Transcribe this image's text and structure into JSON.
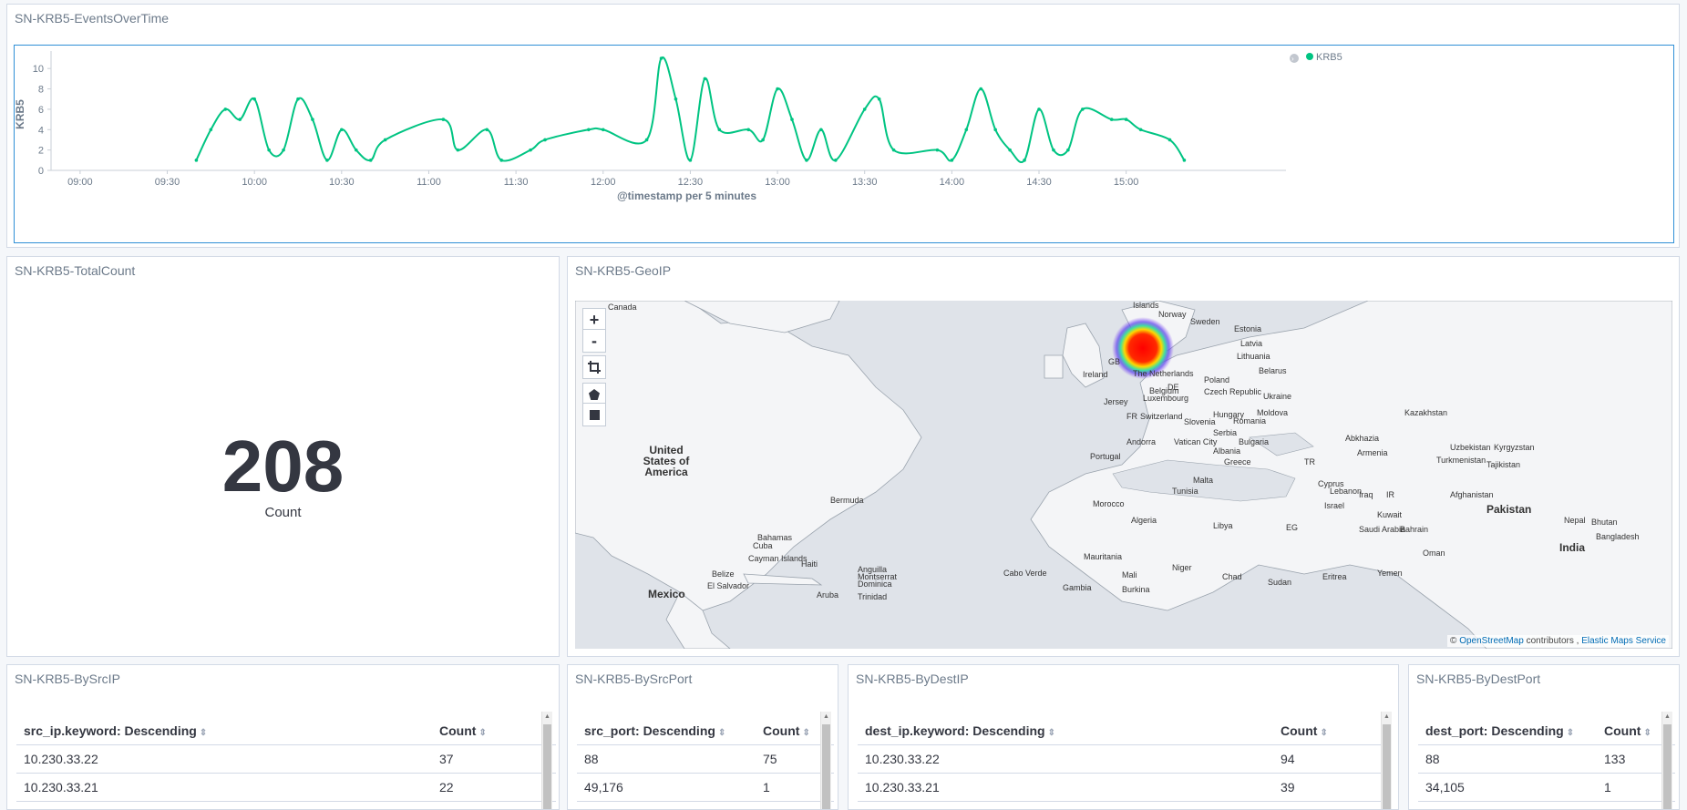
{
  "panels": {
    "events": {
      "title": "SN-KRB5-EventsOverTime"
    },
    "total": {
      "title": "SN-KRB5-TotalCount",
      "value": "208",
      "label": "Count"
    },
    "geo": {
      "title": "SN-KRB5-GeoIP"
    },
    "srcip": {
      "title": "SN-KRB5-BySrcIP",
      "headers": [
        "src_ip.keyword: Descending",
        "Count"
      ],
      "rows": [
        [
          "10.230.33.22",
          "37"
        ],
        [
          "10.230.33.21",
          "22"
        ]
      ]
    },
    "srcport": {
      "title": "SN-KRB5-BySrcPort",
      "headers": [
        "src_port: Descending",
        "Count"
      ],
      "rows": [
        [
          "88",
          "75"
        ],
        [
          "49,176",
          "1"
        ]
      ]
    },
    "destip": {
      "title": "SN-KRB5-ByDestIP",
      "headers": [
        "dest_ip.keyword: Descending",
        "Count"
      ],
      "rows": [
        [
          "10.230.33.22",
          "94"
        ],
        [
          "10.230.33.21",
          "39"
        ]
      ]
    },
    "destport": {
      "title": "SN-KRB5-ByDestPort",
      "headers": [
        "dest_port: Descending",
        "Count"
      ],
      "rows": [
        [
          "88",
          "133"
        ],
        [
          "34,105",
          "1"
        ]
      ]
    }
  },
  "chart_data": {
    "type": "line",
    "xlabel": "@timestamp per 5 minutes",
    "ylabel": "KRB5",
    "legend": {
      "position": "top-right",
      "entries": [
        "KRB5"
      ]
    },
    "color": "#00c482",
    "ylim": [
      0,
      11
    ],
    "yticks": [
      0,
      2,
      4,
      6,
      8,
      10
    ],
    "xticks": [
      "09:00",
      "09:30",
      "10:00",
      "10:30",
      "11:00",
      "11:30",
      "12:00",
      "12:30",
      "13:00",
      "13:30",
      "14:00",
      "14:30",
      "15:00"
    ],
    "series": [
      {
        "name": "KRB5",
        "points": [
          [
            "09:40",
            1
          ],
          [
            "09:45",
            4
          ],
          [
            "09:50",
            6
          ],
          [
            "09:55",
            5
          ],
          [
            "10:00",
            7
          ],
          [
            "10:05",
            2
          ],
          [
            "10:10",
            2
          ],
          [
            "10:15",
            7
          ],
          [
            "10:20",
            5
          ],
          [
            "10:25",
            1
          ],
          [
            "10:30",
            4
          ],
          [
            "10:35",
            2
          ],
          [
            "10:40",
            1
          ],
          [
            "10:45",
            3
          ],
          [
            "11:05",
            5
          ],
          [
            "11:10",
            2
          ],
          [
            "11:20",
            4
          ],
          [
            "11:25",
            1
          ],
          [
            "11:35",
            2
          ],
          [
            "11:40",
            3
          ],
          [
            "11:55",
            4
          ],
          [
            "12:00",
            4
          ],
          [
            "12:15",
            3
          ],
          [
            "12:20",
            11
          ],
          [
            "12:25",
            7
          ],
          [
            "12:30",
            1
          ],
          [
            "12:35",
            9
          ],
          [
            "12:40",
            4
          ],
          [
            "12:50",
            4
          ],
          [
            "12:55",
            3
          ],
          [
            "13:00",
            8
          ],
          [
            "13:05",
            5
          ],
          [
            "13:10",
            1
          ],
          [
            "13:15",
            4
          ],
          [
            "13:20",
            1
          ],
          [
            "13:30",
            6
          ],
          [
            "13:35",
            7
          ],
          [
            "13:40",
            2
          ],
          [
            "13:55",
            2
          ],
          [
            "14:00",
            1
          ],
          [
            "14:05",
            4
          ],
          [
            "14:10",
            8
          ],
          [
            "14:15",
            4
          ],
          [
            "14:20",
            2
          ],
          [
            "14:25",
            1
          ],
          [
            "14:30",
            6
          ],
          [
            "14:35",
            2
          ],
          [
            "14:40",
            2
          ],
          [
            "14:45",
            6
          ],
          [
            "14:55",
            5
          ],
          [
            "15:00",
            5
          ],
          [
            "15:05",
            4
          ],
          [
            "15:15",
            3
          ],
          [
            "15:20",
            1
          ]
        ]
      }
    ]
  },
  "map": {
    "controls": [
      "+",
      "-",
      "crop",
      "polygon",
      "rectangle"
    ],
    "labels": [
      "Canada",
      "United States of America",
      "Mexico",
      "Bermuda",
      "Bahamas",
      "Cuba",
      "Haiti",
      "Cayman Islands",
      "Belize",
      "El Salvador",
      "Anguilla",
      "Montserrat",
      "Dominica",
      "Aruba",
      "Trinidad",
      "Islands",
      "Norway",
      "Sweden",
      "Estonia",
      "Latvia",
      "Lithuania",
      "Belarus",
      "GB",
      "Ireland",
      "The Netherlands",
      "Belgium",
      "Luxembourg",
      "DE",
      "Poland",
      "Czech Republic",
      "Ukraine",
      "Kazakhstan",
      "Jersey",
      "FR",
      "Switzerland",
      "Slovenia",
      "Hungary",
      "Moldova",
      "Romania",
      "Serbia",
      "Bulgaria",
      "Andorra",
      "Vatican City",
      "Albania",
      "Abkhazia",
      "Armenia",
      "Uzbekistan",
      "Kyrgyzstan",
      "Turkmenistan",
      "Tajikistan",
      "Portugal",
      "Greece",
      "TR",
      "Malta",
      "Cyprus",
      "Lebanon",
      "Iraq",
      "IR",
      "Afghanistan",
      "Pakistan",
      "Tunisia",
      "Israel",
      "Kuwait",
      "Morocco",
      "Algeria",
      "Libya",
      "EG",
      "Saudi Arabia",
      "Bahrain",
      "Nepal",
      "Bhutan",
      "Bangladesh",
      "India",
      "Oman",
      "Mauritania",
      "Mali",
      "Niger",
      "Chad",
      "Sudan",
      "Eritrea",
      "Yemen",
      "Cabo Verde",
      "Gambia",
      "Burkina"
    ],
    "attribution_prefix": "©",
    "attribution_link1": "OpenStreetMap",
    "attribution_mid": "contributors ,",
    "attribution_link2": "Elastic Maps Service"
  }
}
